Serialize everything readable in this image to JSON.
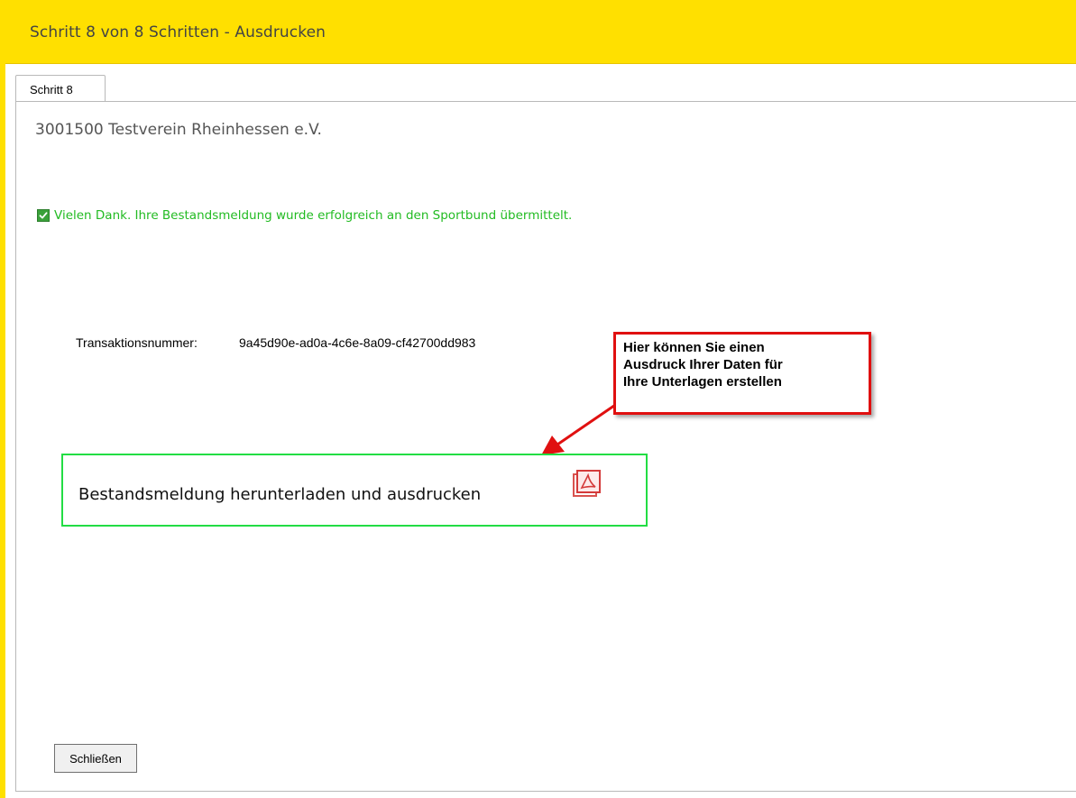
{
  "window": {
    "title": "Schritt 8 von 8 Schritten - Ausdrucken"
  },
  "tabs": [
    {
      "label": "Schritt 8",
      "active": true
    }
  ],
  "club": {
    "name": "3001500 Testverein Rheinhessen e.V."
  },
  "status": {
    "message": "Vielen Dank. Ihre Bestandsmeldung wurde erfolgreich an den Sportbund übermittelt.",
    "icon": "checkbox-checked-icon",
    "color": "#22bb22"
  },
  "transaction": {
    "label": "Transaktionsnummer:",
    "value": "9a45d90e-ad0a-4c6e-8a09-cf42700dd983"
  },
  "callout": {
    "lines": [
      "Hier können Sie einen",
      "Ausdruck Ihrer Daten für",
      "Ihre Unterlagen erstellen"
    ],
    "border_color": "#e01010"
  },
  "download": {
    "label": "Bestandsmeldung herunterladen und ausdrucken",
    "icon": "pdf-icon",
    "highlight_color": "#22dd44"
  },
  "footer": {
    "close_label": "Schließen"
  },
  "colors": {
    "accent": "#FFE000"
  }
}
